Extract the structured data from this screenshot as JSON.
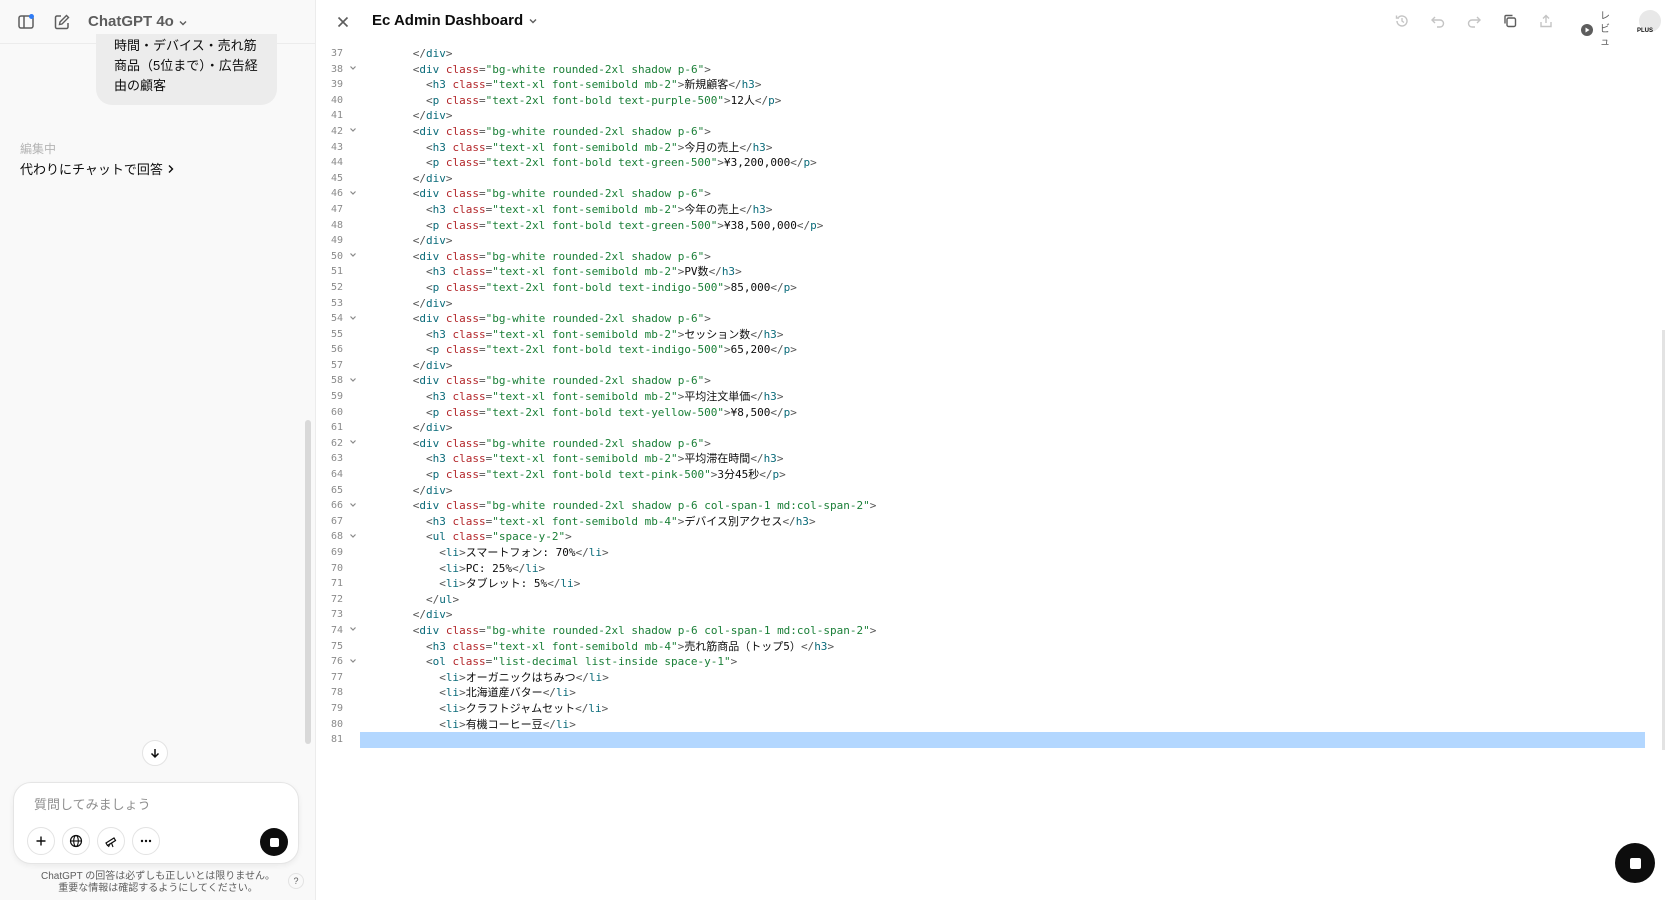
{
  "sidebar": {
    "model": "ChatGPT 4o",
    "bubble_lines": [
      "時間・デバイス・売れ筋",
      "商品（5位まで）・広告経",
      "由の顧客"
    ],
    "edit_label": "編集中",
    "edit_link": "代わりにチャットで回答",
    "composer_placeholder": "質問してみましょう",
    "disclaimer": "ChatGPT の回答は必ずしも正しいとは限りません。重要な情報は確認するようにしてください。",
    "help": "?"
  },
  "canvas": {
    "title": "Ec Admin Dashboard",
    "review": "レビュ",
    "plus": "PLUS"
  },
  "code_lines": [
    {
      "n": "37",
      "fold": "",
      "indent": 8,
      "text": "</div>"
    },
    {
      "n": "38",
      "fold": "v",
      "indent": 8,
      "text": "<div class=\"bg-white rounded-2xl shadow p-6\">"
    },
    {
      "n": "39",
      "fold": "",
      "indent": 10,
      "text": "<h3 class=\"text-xl font-semibold mb-2\">新規顧客</h3>"
    },
    {
      "n": "40",
      "fold": "",
      "indent": 10,
      "text": "<p class=\"text-2xl font-bold text-purple-500\">12人</p>"
    },
    {
      "n": "41",
      "fold": "",
      "indent": 8,
      "text": "</div>"
    },
    {
      "n": "42",
      "fold": "v",
      "indent": 8,
      "text": "<div class=\"bg-white rounded-2xl shadow p-6\">"
    },
    {
      "n": "43",
      "fold": "",
      "indent": 10,
      "text": "<h3 class=\"text-xl font-semibold mb-2\">今月の売上</h3>"
    },
    {
      "n": "44",
      "fold": "",
      "indent": 10,
      "text": "<p class=\"text-2xl font-bold text-green-500\">¥3,200,000</p>"
    },
    {
      "n": "45",
      "fold": "",
      "indent": 8,
      "text": "</div>"
    },
    {
      "n": "46",
      "fold": "v",
      "indent": 8,
      "text": "<div class=\"bg-white rounded-2xl shadow p-6\">"
    },
    {
      "n": "47",
      "fold": "",
      "indent": 10,
      "text": "<h3 class=\"text-xl font-semibold mb-2\">今年の売上</h3>"
    },
    {
      "n": "48",
      "fold": "",
      "indent": 10,
      "text": "<p class=\"text-2xl font-bold text-green-500\">¥38,500,000</p>"
    },
    {
      "n": "49",
      "fold": "",
      "indent": 8,
      "text": "</div>"
    },
    {
      "n": "50",
      "fold": "v",
      "indent": 8,
      "text": "<div class=\"bg-white rounded-2xl shadow p-6\">"
    },
    {
      "n": "51",
      "fold": "",
      "indent": 10,
      "text": "<h3 class=\"text-xl font-semibold mb-2\">PV数</h3>"
    },
    {
      "n": "52",
      "fold": "",
      "indent": 10,
      "text": "<p class=\"text-2xl font-bold text-indigo-500\">85,000</p>"
    },
    {
      "n": "53",
      "fold": "",
      "indent": 8,
      "text": "</div>"
    },
    {
      "n": "54",
      "fold": "v",
      "indent": 8,
      "text": "<div class=\"bg-white rounded-2xl shadow p-6\">"
    },
    {
      "n": "55",
      "fold": "",
      "indent": 10,
      "text": "<h3 class=\"text-xl font-semibold mb-2\">セッション数</h3>"
    },
    {
      "n": "56",
      "fold": "",
      "indent": 10,
      "text": "<p class=\"text-2xl font-bold text-indigo-500\">65,200</p>"
    },
    {
      "n": "57",
      "fold": "",
      "indent": 8,
      "text": "</div>"
    },
    {
      "n": "58",
      "fold": "v",
      "indent": 8,
      "text": "<div class=\"bg-white rounded-2xl shadow p-6\">"
    },
    {
      "n": "59",
      "fold": "",
      "indent": 10,
      "text": "<h3 class=\"text-xl font-semibold mb-2\">平均注文単価</h3>"
    },
    {
      "n": "60",
      "fold": "",
      "indent": 10,
      "text": "<p class=\"text-2xl font-bold text-yellow-500\">¥8,500</p>"
    },
    {
      "n": "61",
      "fold": "",
      "indent": 8,
      "text": "</div>"
    },
    {
      "n": "62",
      "fold": "v",
      "indent": 8,
      "text": "<div class=\"bg-white rounded-2xl shadow p-6\">"
    },
    {
      "n": "63",
      "fold": "",
      "indent": 10,
      "text": "<h3 class=\"text-xl font-semibold mb-2\">平均滞在時間</h3>"
    },
    {
      "n": "64",
      "fold": "",
      "indent": 10,
      "text": "<p class=\"text-2xl font-bold text-pink-500\">3分45秒</p>"
    },
    {
      "n": "65",
      "fold": "",
      "indent": 8,
      "text": "</div>"
    },
    {
      "n": "66",
      "fold": "v",
      "indent": 8,
      "text": "<div class=\"bg-white rounded-2xl shadow p-6 col-span-1 md:col-span-2\">"
    },
    {
      "n": "67",
      "fold": "",
      "indent": 10,
      "text": "<h3 class=\"text-xl font-semibold mb-4\">デバイス別アクセス</h3>"
    },
    {
      "n": "68",
      "fold": "v",
      "indent": 10,
      "text": "<ul class=\"space-y-2\">"
    },
    {
      "n": "69",
      "fold": "",
      "indent": 12,
      "text": "<li>スマートフォン: 70%</li>"
    },
    {
      "n": "70",
      "fold": "",
      "indent": 12,
      "text": "<li>PC: 25%</li>"
    },
    {
      "n": "71",
      "fold": "",
      "indent": 12,
      "text": "<li>タブレット: 5%</li>"
    },
    {
      "n": "72",
      "fold": "",
      "indent": 10,
      "text": "</ul>"
    },
    {
      "n": "73",
      "fold": "",
      "indent": 8,
      "text": "</div>"
    },
    {
      "n": "74",
      "fold": "v",
      "indent": 8,
      "text": "<div class=\"bg-white rounded-2xl shadow p-6 col-span-1 md:col-span-2\">"
    },
    {
      "n": "75",
      "fold": "",
      "indent": 10,
      "text": "<h3 class=\"text-xl font-semibold mb-4\">売れ筋商品（トップ5）</h3>"
    },
    {
      "n": "76",
      "fold": "v",
      "indent": 10,
      "text": "<ol class=\"list-decimal list-inside space-y-1\">"
    },
    {
      "n": "77",
      "fold": "",
      "indent": 12,
      "text": "<li>オーガニックはちみつ</li>"
    },
    {
      "n": "78",
      "fold": "",
      "indent": 12,
      "text": "<li>北海道産バター</li>"
    },
    {
      "n": "79",
      "fold": "",
      "indent": 12,
      "text": "<li>クラフトジャムセット</li>"
    },
    {
      "n": "80",
      "fold": "",
      "indent": 12,
      "text": "<li>有機コーヒー豆</li>"
    },
    {
      "n": "81",
      "fold": "",
      "indent": 0,
      "text": "",
      "highlight": true
    }
  ]
}
